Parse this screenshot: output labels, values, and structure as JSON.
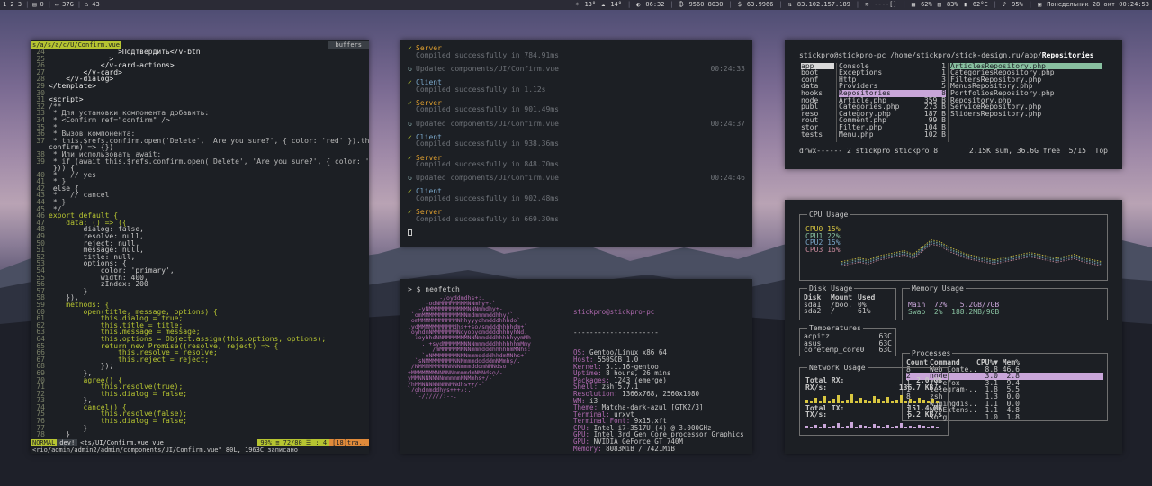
{
  "topbar": {
    "workspaces": "1  2  3",
    "s1": "0",
    "s2": "37G",
    "s3": "43",
    "weather1": "13°",
    "weather2": "14°",
    "time1": "06:32",
    "s4": "9560.8030",
    "s5": "63.9966",
    "ip": "83.102.157.189",
    "s6": "----[]",
    "cpu": "62%",
    "mem": "83%",
    "temp": "62°C",
    "vol": "95%",
    "date": "Понедельник 28 окт 00:24:53"
  },
  "vim": {
    "tab": "s/a/s/a/c/U/Confirm.vue",
    "buffers": "buffers",
    "lines": [
      {
        "n": "24",
        "t": "                >Подтвердить</v-btn"
      },
      {
        "n": "25",
        "t": "              >"
      },
      {
        "n": "26",
        "t": "            </v-card-actions>"
      },
      {
        "n": "27",
        "t": "        </v-card>"
      },
      {
        "n": "28",
        "t": "    </v-dialog>"
      },
      {
        "n": "29",
        "t": "</template>"
      },
      {
        "n": "30",
        "t": ""
      },
      {
        "n": "31",
        "t": "<script>"
      },
      {
        "n": "32",
        "t": "/**"
      },
      {
        "n": "33",
        "t": " * Для установки компонента добавить:"
      },
      {
        "n": "34",
        "t": " * <Confirm ref=\"confirm\" />"
      },
      {
        "n": "35",
        "t": " *"
      },
      {
        "n": "36",
        "t": " * Вызов компонента:"
      },
      {
        "n": "37",
        "t": " * this.$refs.confirm.open('Delete', 'Are you sure?', { color: 'red' }).then(("
      },
      {
        "n": "  ",
        "t": "confirm) => {})"
      },
      {
        "n": "38",
        "t": " * Или использовать await:"
      },
      {
        "n": "39",
        "t": " * if (await this.$refs.confirm.open('Delete', 'Are you sure?', { color: 'red'"
      },
      {
        "n": "  ",
        "t": " })) {"
      },
      {
        "n": "40",
        "t": " *   // yes"
      },
      {
        "n": "41",
        "t": " * }"
      },
      {
        "n": "42",
        "t": " else {"
      },
      {
        "n": "43",
        "t": " *   // cancel"
      },
      {
        "n": "44",
        "t": " * }"
      },
      {
        "n": "45",
        "t": " */"
      },
      {
        "n": "46",
        "t": "export default {"
      },
      {
        "n": "47",
        "t": "    data: () => ({"
      },
      {
        "n": "48",
        "t": "        dialog: false,"
      },
      {
        "n": "49",
        "t": "        resolve: null,"
      },
      {
        "n": "50",
        "t": "        reject: null,"
      },
      {
        "n": "51",
        "t": "        message: null,"
      },
      {
        "n": "52",
        "t": "        title: null,"
      },
      {
        "n": "53",
        "t": "        options: {"
      },
      {
        "n": "54",
        "t": "            color: 'primary',"
      },
      {
        "n": "55",
        "t": "            width: 400,"
      },
      {
        "n": "56",
        "t": "            zIndex: 200"
      },
      {
        "n": "57",
        "t": "        }"
      },
      {
        "n": "58",
        "t": "    }),"
      },
      {
        "n": "59",
        "t": "    methods: {"
      },
      {
        "n": "60",
        "t": "        open(title, message, options) {"
      },
      {
        "n": "61",
        "t": "            this.dialog = true;"
      },
      {
        "n": "62",
        "t": "            this.title = title;"
      },
      {
        "n": "63",
        "t": "            this.message = message;"
      },
      {
        "n": "64",
        "t": "            this.options = Object.assign(this.options, options);"
      },
      {
        "n": "65",
        "t": "            return new Promise((resolve, reject) => {"
      },
      {
        "n": "66",
        "t": "                this.resolve = resolve;"
      },
      {
        "n": "67",
        "t": "                this.reject = reject;"
      },
      {
        "n": "68",
        "t": "            });"
      },
      {
        "n": "69",
        "t": "        },"
      },
      {
        "n": "70",
        "t": "        agree() {"
      },
      {
        "n": "71",
        "t": "            this.resolve(true);"
      },
      {
        "n": "72",
        "t": "            this.dialog = false;"
      },
      {
        "n": "73",
        "t": "        },"
      },
      {
        "n": "74",
        "t": "        cancel() {"
      },
      {
        "n": "75",
        "t": "            this.resolve(false);"
      },
      {
        "n": "76",
        "t": "            this.dialog = false;"
      },
      {
        "n": "77",
        "t": "        }"
      },
      {
        "n": "78",
        "t": "    }"
      }
    ],
    "status": {
      "mode": "NORMAL",
      "branch": "dev!",
      "file": "<ts/UI/Confirm.vue  vue",
      "percent": "90% ≡ 72/80 ☰ : 4",
      "warn": "[18]tra.."
    },
    "message": "<rio/admin/admin2/admin/components/UI/Confirm.vue\" 80L, 1963C записано"
  },
  "webpack": {
    "groups": [
      {
        "icon": "✓",
        "name": "Server",
        "kind": "server",
        "sub": "Compiled successfully in 784.91ms",
        "time": ""
      },
      {
        "icon": "↻",
        "name": "Updated components/UI/Confirm.vue",
        "kind": "update",
        "sub": "",
        "time": "00:24:33"
      },
      {
        "icon": "✓",
        "name": "Client",
        "kind": "client",
        "sub": "Compiled successfully in 1.12s",
        "time": ""
      },
      {
        "icon": "✓",
        "name": "Server",
        "kind": "server",
        "sub": "Compiled successfully in 901.49ms",
        "time": ""
      },
      {
        "icon": "↻",
        "name": "Updated components/UI/Confirm.vue",
        "kind": "update",
        "sub": "",
        "time": "00:24:37"
      },
      {
        "icon": "✓",
        "name": "Client",
        "kind": "client",
        "sub": "Compiled successfully in 938.36ms",
        "time": ""
      },
      {
        "icon": "✓",
        "name": "Server",
        "kind": "server",
        "sub": "Compiled successfully in 848.70ms",
        "time": ""
      },
      {
        "icon": "↻",
        "name": "Updated components/UI/Confirm.vue",
        "kind": "update",
        "sub": "",
        "time": "00:24:46"
      },
      {
        "icon": "✓",
        "name": "Client",
        "kind": "client",
        "sub": "Compiled successfully in 902.48ms",
        "time": ""
      },
      {
        "icon": "✓",
        "name": "Server",
        "kind": "server",
        "sub": "Compiled successfully in 669.30ms",
        "time": ""
      }
    ]
  },
  "neofetch": {
    "prompt": "> $ neofetch",
    "prompt2": "> $",
    "title": "stickpro@stickpro-pc",
    "separator": "---------------------",
    "logo": [
      "         -/oyddmdhs+:.",
      "     -odNMMMMMMMMNNmhy+-`",
      "   -yNMMMMMMMMMMMNNNmmdhy+-",
      " `omMMMMMMMMMMMMNmdmmmmddhhy/`",
      " omMMMMMMMMMMMNhhyyyohmdddhhhdo`",
      ".ydMMMMMMMMMMdhs++so/smdddhhhhdm+`",
      " oyhdmNMMMMMMMNdyooydmddddhhhyhNd.",
      "  :oyhhdNNMMMMMMMNNNmmdddhhhhhyymMh",
      "    .:+sydNMMMMMNNNmmmdddhhhhhhmMmy",
      "       /mMMMMMMNNNmmmdddhhhhhmMNhs:",
      "    `oNMMMMMMMNNNmmmddddhhdmMNhs+`",
      "  `sNMMMMMMMMNNNmmmdddddmNMmhs/.",
      " /NMMMMMMMMNNNNmmmdddmNMNdso:`",
      "+MMMMMMMNNNNNmmmmdmNMNdso/-",
      "yMMNNNNNNNmmmmmNNMmhs+/-`",
      "/hMMNNNNNNNNMNdhs++/-`",
      "`/ohdmmddhys+++/:.`",
      "  `-//////:--."
    ],
    "info": [
      {
        "k": "OS:",
        "v": " Gentoo/Linux x86_64"
      },
      {
        "k": "Host:",
        "v": " 550SCB 1.0"
      },
      {
        "k": "Kernel:",
        "v": " 5.1.16-gentoo"
      },
      {
        "k": "Uptime:",
        "v": " 8 hours, 26 mins"
      },
      {
        "k": "Packages:",
        "v": " 1243 (emerge)"
      },
      {
        "k": "Shell:",
        "v": " zsh 5.7.1"
      },
      {
        "k": "Resolution:",
        "v": " 1366x768, 2560x1080"
      },
      {
        "k": "WM:",
        "v": " i3"
      },
      {
        "k": "Theme:",
        "v": " Matcha-dark-azul [GTK2/3]"
      },
      {
        "k": "Terminal:",
        "v": " urxvt"
      },
      {
        "k": "Terminal Font:",
        "v": " 9x15,xft"
      },
      {
        "k": "CPU:",
        "v": " Intel i7-3517U (4) @ 3.000GHz"
      },
      {
        "k": "GPU:",
        "v": " Intel 3rd Gen Core processor Graphics"
      },
      {
        "k": "GPU:",
        "v": " NVIDIA GeForce GT 740M"
      },
      {
        "k": "Memory:",
        "v": " 8083MiB / 7421MiB"
      }
    ],
    "colors": [
      "#6a6a6a",
      "#c86a8a",
      "#a6c87a",
      "#d8c6a0",
      "#7aa6c8",
      "#b08ac8",
      "#8ac8c0",
      "#d8d8d8"
    ]
  },
  "ranger": {
    "path_prefix": "stickpro@stickpro-pc /home/stickpro/stick-design.ru/app/",
    "path_current": "Repositories",
    "col1": [
      "app",
      "boot",
      "conf",
      "data",
      "hooks",
      "node",
      "publ",
      "reso",
      "rout",
      "stor",
      "tests"
    ],
    "col2": [
      {
        "name": "Console",
        "size": "1"
      },
      {
        "name": "Exceptions",
        "size": "1"
      },
      {
        "name": "Http",
        "size": "3"
      },
      {
        "name": "Providers",
        "size": "5"
      },
      {
        "name": "Repositories",
        "size": "8"
      },
      {
        "name": "Article.php",
        "size": "359 B"
      },
      {
        "name": "Categories.php",
        "size": "273 B"
      },
      {
        "name": "Category.php",
        "size": "187 B"
      },
      {
        "name": "Comment.php",
        "size": "99 B"
      },
      {
        "name": "Filter.php",
        "size": "104 B"
      },
      {
        "name": "Menu.php",
        "size": "102 B"
      }
    ],
    "col3": [
      "ArticlesRepository.php",
      "CategoriesRepository.php",
      "FiltersRepository.php",
      "MenusRepository.php",
      "PortfoliosRepository.php",
      "Repository.php",
      "ServiceRepository.php",
      "SlidersRepository.php"
    ],
    "footer_left": "drwx------ 2 stickpro stickpro 8",
    "footer_right": "2.15K sum, 36.6G free  5/15  Top"
  },
  "gotop": {
    "cpu_title": "CPU Usage",
    "cpus": [
      {
        "name": "CPU0",
        "value": "15%"
      },
      {
        "name": "CPU1",
        "value": "22%"
      },
      {
        "name": "CPU2",
        "value": "15%"
      },
      {
        "name": "CPU3",
        "value": "16%"
      }
    ],
    "disk_title": "Disk Usage",
    "disk_header": [
      "Disk",
      "Mount",
      "Used"
    ],
    "disks": [
      {
        "d": "sda1",
        "m": "/boo.",
        "u": "0%"
      },
      {
        "d": "sda2",
        "m": "/",
        "u": "61%"
      }
    ],
    "mem_title": "Memory Usage",
    "mem_main": "Main  72%   5.2GB/7GB",
    "mem_swap": "Swap  2%  188.2MB/9GB",
    "temp_title": "Temperatures",
    "temps": [
      {
        "n": "acpitz",
        "v": "63C"
      },
      {
        "n": "asus",
        "v": "63C"
      },
      {
        "n": "coretemp_core0",
        "v": "63C"
      }
    ],
    "net_title": "Network Usage",
    "total_rx_label": "Total RX:",
    "total_rx": "2.0 GB",
    "rx_label": "RX/s:",
    "rx": "136.7 KB/s",
    "total_tx_label": "Total TX:",
    "total_tx": "151.4 MB",
    "tx_label": "TX/s:",
    "tx": "5.2 KB/s",
    "proc_title": "Processes",
    "proc_header": [
      "Count",
      "Command",
      "CPU%▼",
      "Mem%"
    ],
    "procs": [
      {
        "c": "8",
        "cmd": "Web Conte..",
        "cpu": "8.8",
        "mem": "46.6"
      },
      {
        "c": "2",
        "cmd": "node",
        "cpu": "3.0",
        "mem": "2.8"
      },
      {
        "c": "1",
        "cmd": "firefox",
        "cpu": "3.1",
        "mem": "9.4"
      },
      {
        "c": "1",
        "cmd": "telegram-..",
        "cpu": "1.8",
        "mem": "5.5"
      },
      {
        "c": "8",
        "cmd": "zsh",
        "cpu": "1.3",
        "mem": "0.0"
      },
      {
        "c": "1",
        "cmd": "w3mimgdis..",
        "cpu": "1.1",
        "mem": "0.0"
      },
      {
        "c": "1",
        "cmd": "WebExtens..",
        "cpu": "1.1",
        "mem": "4.8"
      },
      {
        "c": "1",
        "cmd": "Xorg",
        "cpu": "1.0",
        "mem": "1.8"
      }
    ]
  }
}
